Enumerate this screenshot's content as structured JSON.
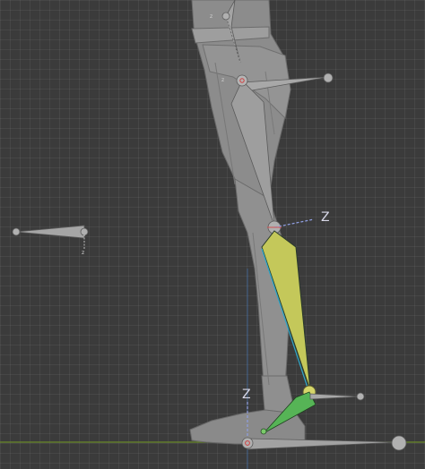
{
  "viewport": {
    "background_color": "#3b3b3b",
    "grid_color": "#4a4a4a",
    "ground_line_color": "#6a8a2a",
    "mesh_color": "#8e8e8e",
    "bone_color": "#9b9b9b",
    "active_bone_color": "#c9cc5a",
    "selected_bone_color": "#5fbf5a"
  },
  "gizmo_labels": {
    "knee_axis": "Z",
    "foot_axis": "Z",
    "hand_axis": "z",
    "hip_axis": "z",
    "top_axis": "z"
  }
}
